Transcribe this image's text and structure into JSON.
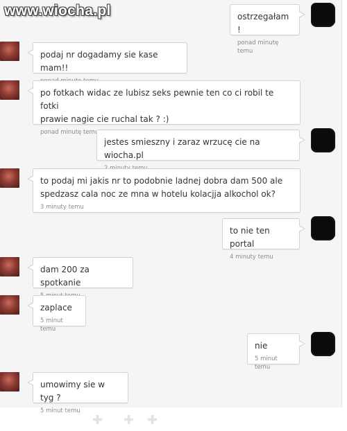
{
  "watermark": "www.wiocha.pl",
  "messages": [
    {
      "side": "right",
      "text": "ostrzegałam !",
      "time": "ponad minutę temu"
    },
    {
      "side": "left",
      "text": "podaj nr dogadamy sie kase mam!!",
      "time": "ponad minutę temu"
    },
    {
      "side": "left",
      "text": "po fotkach widac ze lubisz seks pewnie ten co ci robil te fotki\nprawie nagie cie ruchal tak ? :)",
      "time": "ponad minutę temu"
    },
    {
      "side": "right",
      "text": "jestes smieszny i zaraz wrzucę cie na wiocha.pl",
      "time": "2 minuty temu"
    },
    {
      "side": "left",
      "text": "to podaj mi jakis nr to podobnie ladnej dobra dam 500 ale\nspedzasz cala noc ze mna w hotelu kolacjja alkochol ok?",
      "time": "3 minuty temu"
    },
    {
      "side": "right",
      "text": "to nie ten portal",
      "time": "4 minuty temu"
    },
    {
      "side": "left",
      "text": "dam 200 za spotkanie",
      "time": "5 minut temu"
    },
    {
      "side": "left",
      "text": "zaplace",
      "time": "5 minut temu"
    },
    {
      "side": "right",
      "text": "nie",
      "time": "5 minut temu"
    },
    {
      "side": "left",
      "text": "umowimy sie w tyg ?",
      "time": "5 minut temu"
    }
  ]
}
